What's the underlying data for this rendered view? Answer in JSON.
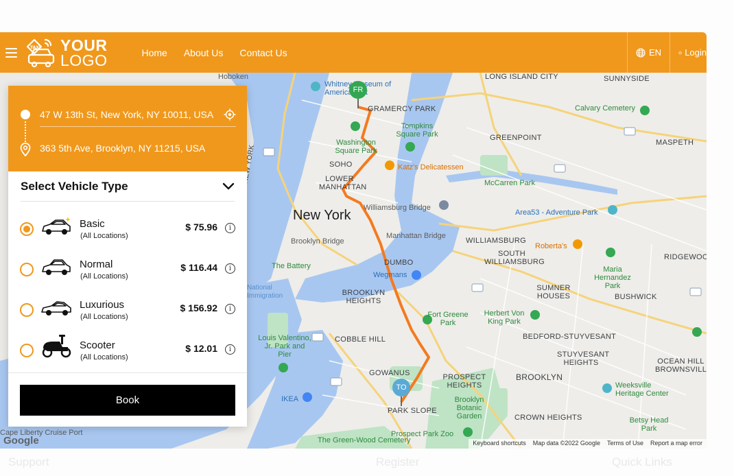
{
  "header": {
    "logo_line1": "YOUR",
    "logo_line2": "LOGO",
    "nav": [
      "Home",
      "About Us",
      "Contact Us"
    ],
    "language": "EN",
    "login": "Login"
  },
  "trip": {
    "from": "47 W 13th St, New York, NY 10011, USA",
    "to": "363 5th Ave, Brooklyn, NY 11215, USA"
  },
  "vehicle_panel": {
    "title": "Select Vehicle Type",
    "book_label": "Book",
    "selected_index": 0,
    "vehicles": [
      {
        "name": "Basic",
        "subtitle": "(All Locations)",
        "price": "$ 75.96",
        "icon": "car-sparkle-icon"
      },
      {
        "name": "Normal",
        "subtitle": "(All Locations)",
        "price": "$ 116.44",
        "icon": "car-icon"
      },
      {
        "name": "Luxurious",
        "subtitle": "(All Locations)",
        "price": "$ 156.92",
        "icon": "luxury-car-icon"
      },
      {
        "name": "Scooter",
        "subtitle": "(All Locations)",
        "price": "$ 12.01",
        "icon": "scooter-icon"
      }
    ]
  },
  "map": {
    "from_marker": "FR",
    "to_marker": "TO",
    "labels": {
      "new_york": "New York",
      "hoboken": "Hoboken",
      "long_island_city": "LONG ISLAND CITY",
      "sunnyside": "SUNNYSIDE",
      "whitney": "Whitney Museum of American Art",
      "gramercy": "GRAMERCY PARK",
      "calvary": "Calvary Cemetery",
      "tompkins": "Tompkins Square Park",
      "washington": "Washington Square Park",
      "soho": "SOHO",
      "katz": "Katz's Delicatessen",
      "greenpoint": "GREENPOINT",
      "maspeth": "MASPETH",
      "lower_manhattan": "LOWER MANHATTAN",
      "mccarren": "McCarren Park",
      "williamsburg_bridge": "Williamsburg Bridge",
      "area53": "Area53 - Adventure Park",
      "new_jersey": "NEW JERSEY NEW YORK",
      "brooklyn_bridge": "Brooklyn Bridge",
      "manhattan_bridge": "Manhattan Bridge",
      "williamsburg": "WILLIAMSBURG",
      "robertas": "Roberta's",
      "south_williamsburg": "SOUTH WILLIAMSBURG",
      "ridgewood": "RIDGEWOOD",
      "the_battery": "The Battery",
      "dumbo": "DUMBO",
      "wegmans": "Wegmans",
      "maria_hernandez": "Maria Hernandez Park",
      "ellis": "National Immigration",
      "brooklyn_heights": "BROOKLYN HEIGHTS",
      "sumner": "SUMNER HOUSES",
      "bushwick": "BUSHWICK",
      "fort_greene": "Fort Greene Park",
      "herbert_von": "Herbert Von King Park",
      "cobble_hill": "COBBLE HILL",
      "bed_stuy": "BEDFORD-STUYVESANT",
      "louis_valentino": "Louis Valentino, Jr. Park and Pier",
      "stuyvesant_heights": "STUYVESANT HEIGHTS",
      "ocean_hill": "OCEAN HILL BROWNSVILLE",
      "gowanus": "GOWANUS",
      "prospect_heights": "PROSPECT HEIGHTS",
      "brooklyn": "BROOKLYN",
      "weeksville": "Weeksville Heritage Center",
      "ikea": "IKEA",
      "park_slope": "PARK SLOPE",
      "botanic": "Brooklyn Botanic Garden",
      "crown_heights": "CROWN HEIGHTS",
      "betsy": "Betsy Head Park",
      "cape_liberty": "Cape Liberty Cruise Port",
      "green_wood": "The Green-Wood Cemetery",
      "prospect_zoo": "Prospect Park Zoo"
    },
    "attribution": [
      "Keyboard shortcuts",
      "Map data ©2022 Google",
      "Terms of Use",
      "Report a map error"
    ],
    "google": "Google"
  },
  "colors": {
    "brand": "#f0981c",
    "route": "#f47a1f",
    "book_button": "#000000"
  },
  "footer_ghost": [
    "Support",
    "Register",
    "Quick Links"
  ]
}
